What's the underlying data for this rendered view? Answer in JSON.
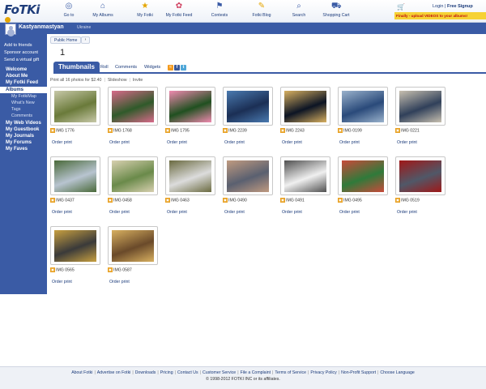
{
  "brand": {
    "logo_text": "FoTKi"
  },
  "topnav": [
    {
      "label": "Go to",
      "icon": "go-to-icon",
      "glyph": "◎"
    },
    {
      "label": "My Albums",
      "icon": "albums-icon",
      "glyph": "⌂"
    },
    {
      "label": "My Fotki",
      "icon": "star-icon",
      "glyph": "★"
    },
    {
      "label": "My Fotki Feed",
      "icon": "feed-icon",
      "glyph": "✿"
    },
    {
      "label": "Contests",
      "icon": "contests-icon",
      "glyph": "⚑"
    },
    {
      "label": "Fotki Blog",
      "icon": "blog-icon",
      "glyph": "✎"
    },
    {
      "label": "Search",
      "icon": "search-icon",
      "glyph": "⌕"
    },
    {
      "label": "Shopping Cart",
      "icon": "shopping-cart-icon",
      "glyph": "⛟"
    }
  ],
  "account": {
    "login": "Login",
    "separator": "|",
    "signup": "Free Signup",
    "promo": "Finally - upload VIDEOS to your albums!"
  },
  "user": {
    "name": "Kastyanmastyan",
    "country": "Ukraine"
  },
  "side_links": [
    "Add to friends",
    "Sponsor account",
    "Send a virtual gift"
  ],
  "side_nav": [
    {
      "label": "Welcome",
      "type": "main"
    },
    {
      "label": "About Me",
      "type": "main"
    },
    {
      "label": "My Fotki Feed",
      "type": "main"
    },
    {
      "label": "Albums",
      "type": "active"
    },
    {
      "label": "My FotkiMap",
      "type": "sub"
    },
    {
      "label": "What's New",
      "type": "sub"
    },
    {
      "label": "Tags",
      "type": "sub"
    },
    {
      "label": "Comments",
      "type": "sub"
    },
    {
      "label": "My Web Videos",
      "type": "main"
    },
    {
      "label": "My Guestbook",
      "type": "main"
    },
    {
      "label": "My Journals",
      "type": "main"
    },
    {
      "label": "My Forums",
      "type": "main"
    },
    {
      "label": "My Faves",
      "type": "main"
    }
  ],
  "main": {
    "public_home": "Public Home",
    "public_home_arrow": "›",
    "page_number": "1",
    "tabs": [
      "Thumbnails",
      "Roll",
      "Comments",
      "Widgets"
    ],
    "share_icons": [
      {
        "name": "rss-icon",
        "glyph": "≈",
        "color": "#f39a1e"
      },
      {
        "name": "facebook-icon",
        "glyph": "f",
        "color": "#3b5998"
      },
      {
        "name": "twitter-icon",
        "glyph": "t",
        "color": "#4fa7d8"
      }
    ],
    "actions": [
      "Print all 16 photos for $2.40",
      "Slideshow",
      "Invite"
    ]
  },
  "photos": [
    {
      "caption": "IMG 1776",
      "order": "Order print",
      "c1": "#6a7a3a",
      "c2": "#c7c8a8"
    },
    {
      "caption": "IMG 1768",
      "order": "Order print",
      "c1": "#2f5a2a",
      "c2": "#d86a8a"
    },
    {
      "caption": "IMG 1795",
      "order": "Order print",
      "c1": "#205020",
      "c2": "#f08ab0"
    },
    {
      "caption": "IMG 2239",
      "order": "Order print",
      "c1": "#1b2f55",
      "c2": "#4a7ab0"
    },
    {
      "caption": "IMG 2243",
      "order": "Order print",
      "c1": "#0c1424",
      "c2": "#d8b060"
    },
    {
      "caption": "IMG 0199",
      "order": "Order print",
      "c1": "#2a4a7a",
      "c2": "#9ab2cc"
    },
    {
      "caption": "IMG 0221",
      "order": "Order print",
      "c1": "#30405a",
      "c2": "#c8c0b0"
    },
    {
      "caption": "IMG 0437",
      "order": "Order print",
      "c1": "#b8c4d0",
      "c2": "#4a6a3a"
    },
    {
      "caption": "IMG 0458",
      "order": "Order print",
      "c1": "#6a8a4a",
      "c2": "#d8d0b0"
    },
    {
      "caption": "IMG 0463",
      "order": "Order print",
      "c1": "#dcdcdc",
      "c2": "#6a6a40"
    },
    {
      "caption": "IMG 0490",
      "order": "Order print",
      "c1": "#5a6070",
      "c2": "#c09a80"
    },
    {
      "caption": "IMG 0491",
      "order": "Order print",
      "c1": "#f0f0f0",
      "c2": "#505050"
    },
    {
      "caption": "IMG 0495",
      "order": "Order print",
      "c1": "#2f7a3a",
      "c2": "#c84a3a"
    },
    {
      "caption": "IMG 0519",
      "order": "Order print",
      "c1": "#505868",
      "c2": "#a01818"
    },
    {
      "caption": "IMG 0565",
      "order": "Order print",
      "c1": "#3a3a3a",
      "c2": "#c8a040"
    },
    {
      "caption": "IMG 0587",
      "order": "Order print",
      "c1": "#6a4a2a",
      "c2": "#d8b060"
    }
  ],
  "footer": {
    "links": [
      "About Fotki",
      "Advertise on Fotki",
      "Downloads",
      "Pricing",
      "Contact Us",
      "Customer Service",
      "File a Complaint",
      "Terms of Service",
      "Privacy Policy",
      "Non-Profit Support",
      "Choose Language"
    ],
    "copyright": "© 1998-2012 FOTKI INC or its affiliates."
  }
}
